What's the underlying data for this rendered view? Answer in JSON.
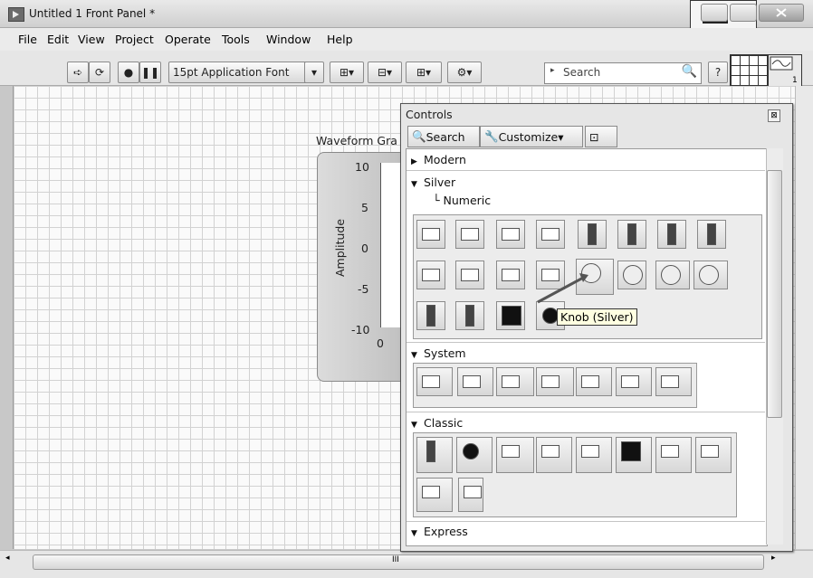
{
  "window": {
    "title": "Untitled 1 Front Panel *"
  },
  "menu": [
    "File",
    "Edit",
    "View",
    "Project",
    "Operate",
    "Tools",
    "Window",
    "Help"
  ],
  "toolbar": {
    "font_label": "15pt Application Font",
    "search_placeholder": "Search",
    "help_label": "?"
  },
  "graph": {
    "label": "Waveform Gra",
    "ylabel": "Amplitude",
    "yticks": [
      "10",
      "5",
      "0",
      "-5",
      "-10"
    ],
    "xtick": "0"
  },
  "palette": {
    "title": "Controls",
    "search_label": "Search",
    "customize_label": "Customize",
    "categories": {
      "modern": "Modern",
      "silver": "Silver",
      "numeric": "Numeric",
      "system": "System",
      "classic": "Classic",
      "express": "Express"
    },
    "tooltip": "Knob (Silver)"
  },
  "scroll": {
    "marker": "III"
  }
}
